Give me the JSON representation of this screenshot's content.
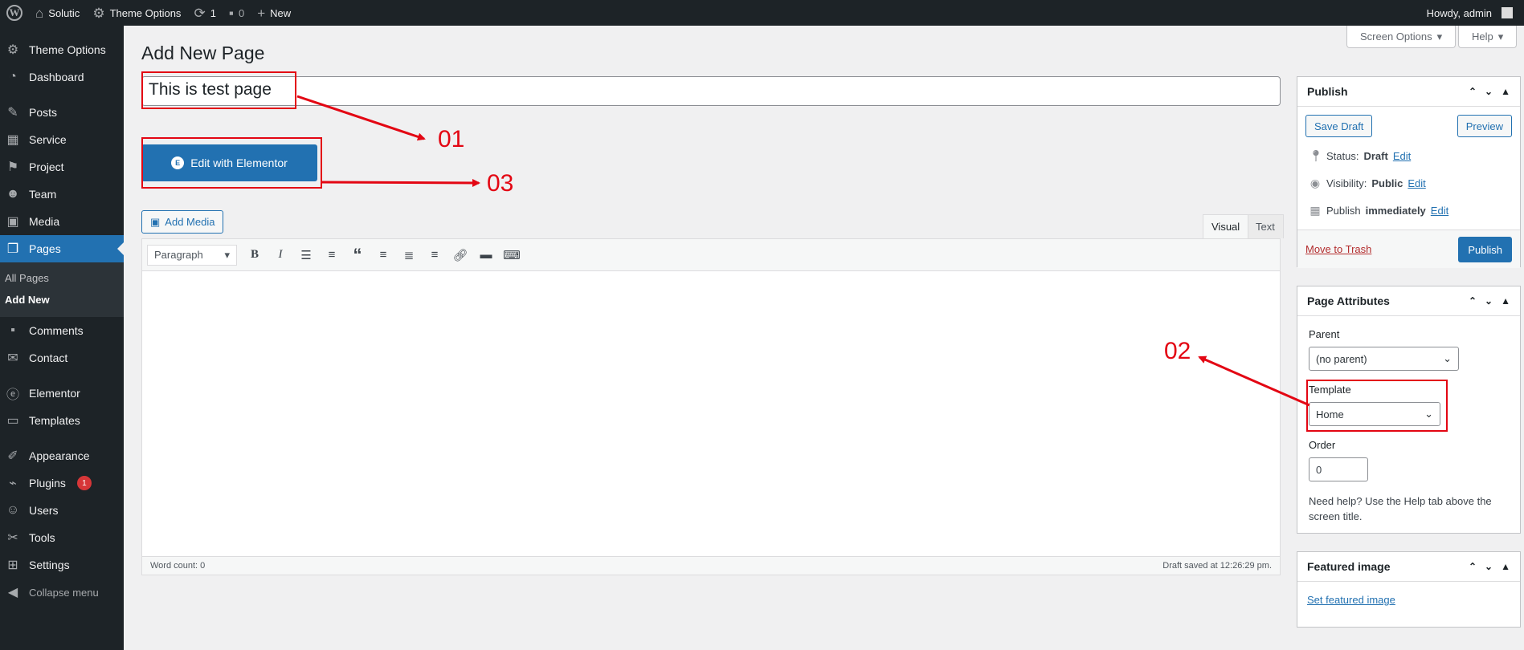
{
  "admin_bar": {
    "site_name": "Solutic",
    "theme_options": "Theme Options",
    "updates_count": "1",
    "comments_count": "0",
    "new_label": "New",
    "howdy": "Howdy, admin"
  },
  "sidebar": {
    "items": [
      {
        "label": "Theme Options",
        "icon": "gear-icon"
      },
      {
        "label": "Dashboard",
        "icon": "dashboard-icon"
      },
      {
        "label": "Posts",
        "icon": "pin-icon"
      },
      {
        "label": "Service",
        "icon": "grid-icon"
      },
      {
        "label": "Project",
        "icon": "flag-icon"
      },
      {
        "label": "Team",
        "icon": "team-icon"
      },
      {
        "label": "Media",
        "icon": "media-icon"
      },
      {
        "label": "Pages",
        "icon": "pages-icon"
      },
      {
        "label": "Comments",
        "icon": "comment-icon"
      },
      {
        "label": "Contact",
        "icon": "mail-icon"
      },
      {
        "label": "Elementor",
        "icon": "elementor-icon"
      },
      {
        "label": "Templates",
        "icon": "folder-icon"
      },
      {
        "label": "Appearance",
        "icon": "brush-icon"
      },
      {
        "label": "Plugins",
        "icon": "plugin-icon",
        "badge": "1"
      },
      {
        "label": "Users",
        "icon": "user-icon"
      },
      {
        "label": "Tools",
        "icon": "wrench-icon"
      },
      {
        "label": "Settings",
        "icon": "settings-icon"
      }
    ],
    "submenu": {
      "all_pages": "All Pages",
      "add_new": "Add New"
    },
    "collapse": "Collapse menu"
  },
  "screen_meta": {
    "screen_options": "Screen Options",
    "help": "Help"
  },
  "page": {
    "title": "Add New Page",
    "post_title": "This is test page",
    "elementor_button": "Edit with Elementor",
    "add_media": "Add Media"
  },
  "editor": {
    "tab_visual": "Visual",
    "tab_text": "Text",
    "format": "Paragraph",
    "word_count": "Word count: 0",
    "draft_saved": "Draft saved at 12:26:29 pm."
  },
  "publish": {
    "title": "Publish",
    "save_draft": "Save Draft",
    "preview": "Preview",
    "status_label": "Status:",
    "status_value": "Draft",
    "visibility_label": "Visibility:",
    "visibility_value": "Public",
    "publish_label": "Publish",
    "publish_value": "immediately",
    "edit": "Edit",
    "move_to_trash": "Move to Trash",
    "publish_button": "Publish"
  },
  "page_attributes": {
    "title": "Page Attributes",
    "parent_label": "Parent",
    "parent_value": "(no parent)",
    "template_label": "Template",
    "template_value": "Home",
    "order_label": "Order",
    "order_value": "0",
    "help": "Need help? Use the Help tab above the screen title."
  },
  "featured_image": {
    "title": "Featured image",
    "link": "Set featured image"
  },
  "annotations": {
    "label_01": "01",
    "label_02": "02",
    "label_03": "03",
    "color": "#e30613"
  },
  "colors": {
    "admin_dark": "#1d2327",
    "accent": "#2271b1",
    "background": "#f0f0f1"
  }
}
